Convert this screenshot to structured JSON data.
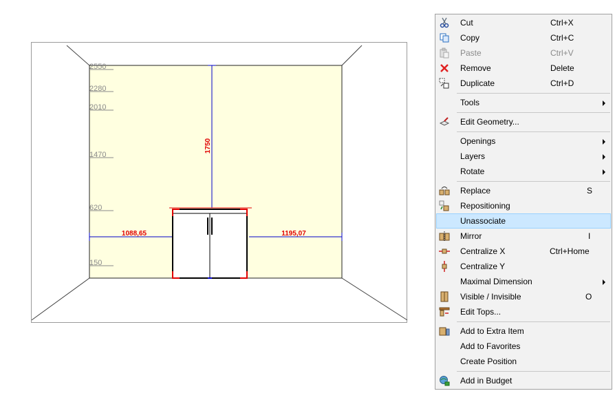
{
  "drawing": {
    "heights": [
      "2550",
      "2280",
      "2010",
      "1470",
      "620",
      "150"
    ],
    "dim_vertical": "1750",
    "dim_left": "1088,65",
    "dim_right": "1195,07"
  },
  "colors": {
    "wall": "#ffffe0",
    "dimension_line": "#0000c8",
    "dimension_text": "#e00000",
    "menu_highlight": "#cce8ff"
  },
  "menu": {
    "items": [
      {
        "label": "Cut",
        "shortcut": "Ctrl+X",
        "icon": "scissors-icon"
      },
      {
        "label": "Copy",
        "shortcut": "Ctrl+C",
        "icon": "copy-icon"
      },
      {
        "label": "Paste",
        "shortcut": "Ctrl+V",
        "icon": "paste-icon",
        "disabled": true
      },
      {
        "label": "Remove",
        "shortcut": "Delete",
        "icon": "red-x-icon"
      },
      {
        "label": "Duplicate",
        "shortcut": "Ctrl+D",
        "icon": "duplicate-icon"
      },
      {
        "label": "Tools",
        "submenu": true
      },
      {
        "label": "Edit Geometry...",
        "icon": "edit-geometry-icon"
      },
      {
        "label": "Openings",
        "submenu": true
      },
      {
        "label": "Layers",
        "submenu": true
      },
      {
        "label": "Rotate",
        "submenu": true
      },
      {
        "label": "Replace",
        "shortcut": "S",
        "icon": "replace-icon"
      },
      {
        "label": "Repositioning",
        "icon": "repositioning-icon"
      },
      {
        "label": "Unassociate",
        "highlighted": true
      },
      {
        "label": "Mirror",
        "shortcut": "I",
        "icon": "mirror-icon"
      },
      {
        "label": "Centralize X",
        "shortcut": "Ctrl+Home",
        "icon": "centralize-x-icon"
      },
      {
        "label": "Centralize Y",
        "icon": "centralize-y-icon"
      },
      {
        "label": "Maximal Dimension",
        "submenu": true
      },
      {
        "label": "Visible / Invisible",
        "shortcut": "O",
        "icon": "visibility-icon"
      },
      {
        "label": "Edit Tops...",
        "icon": "edit-tops-icon"
      },
      {
        "label": "Add to Extra Item",
        "icon": "extra-item-icon"
      },
      {
        "label": "Add to Favorites"
      },
      {
        "label": "Create Position"
      },
      {
        "label": "Add in Budget",
        "icon": "budget-icon"
      }
    ]
  }
}
